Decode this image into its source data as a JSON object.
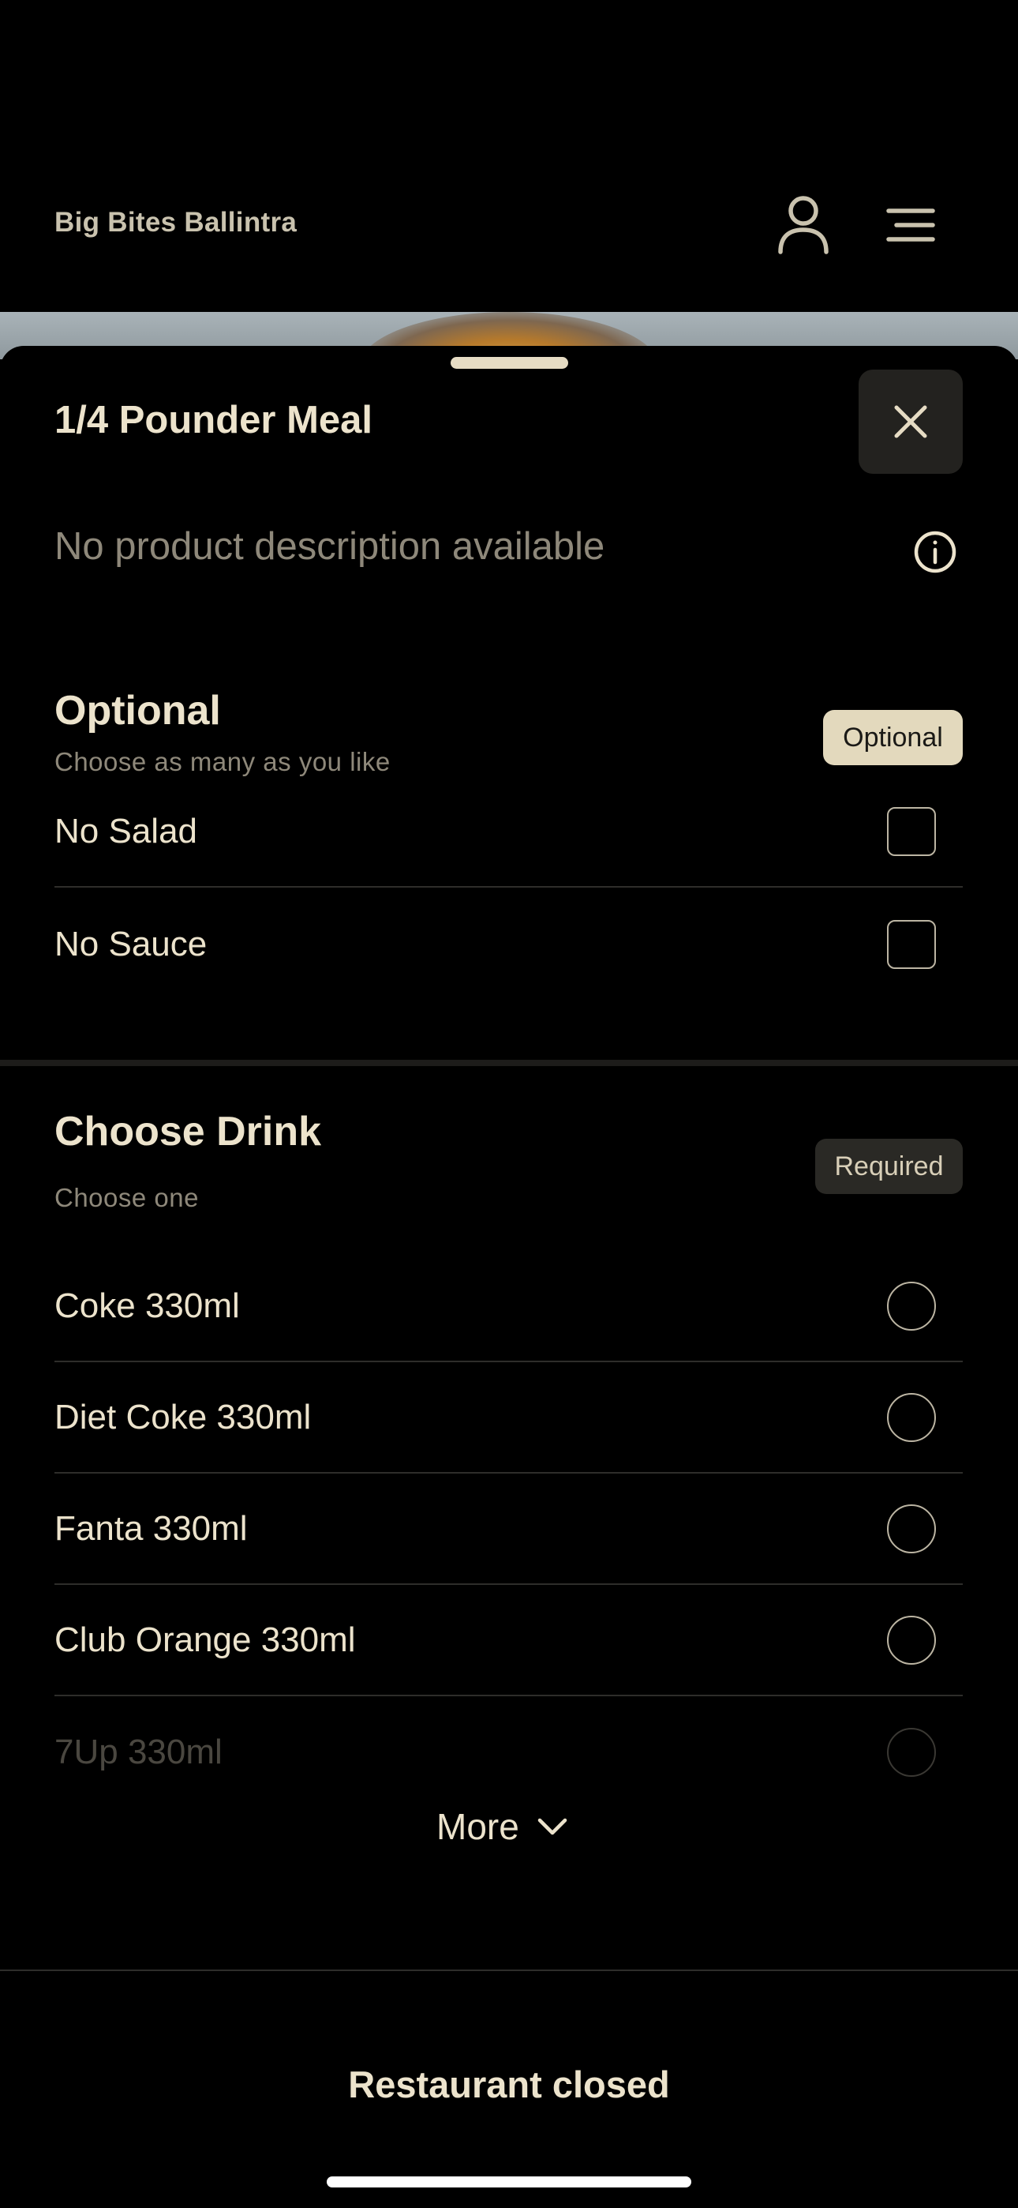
{
  "header": {
    "brand": "Big Bites Ballintra",
    "icons": {
      "user": "user-icon",
      "menu": "menu-icon"
    }
  },
  "sheet": {
    "title": "1/4 Pounder Meal",
    "description": "No product description available",
    "close_icon": "close-icon",
    "info_icon": "info-icon"
  },
  "optional_group": {
    "title": "Optional",
    "subtitle": "Choose as many as you like",
    "badge": "Optional",
    "items": [
      {
        "label": "No Salad",
        "checked": false
      },
      {
        "label": "No Sauce",
        "checked": false
      }
    ]
  },
  "drink_group": {
    "title": "Choose Drink",
    "subtitle": "Choose one",
    "badge": "Required",
    "items": [
      {
        "label": "Coke 330ml",
        "selected": false
      },
      {
        "label": "Diet Coke 330ml",
        "selected": false
      },
      {
        "label": "Fanta 330ml",
        "selected": false
      },
      {
        "label": "Club Orange 330ml",
        "selected": false
      },
      {
        "label": "7Up 330ml",
        "selected": false
      }
    ],
    "more_label": "More"
  },
  "footer": {
    "status": "Restaurant closed"
  },
  "colors": {
    "background": "#000000",
    "text": "#ece3cc",
    "muted": "#8e887a",
    "badge_optional_bg": "#e3d9bd",
    "badge_required_bg": "#2a2925"
  }
}
